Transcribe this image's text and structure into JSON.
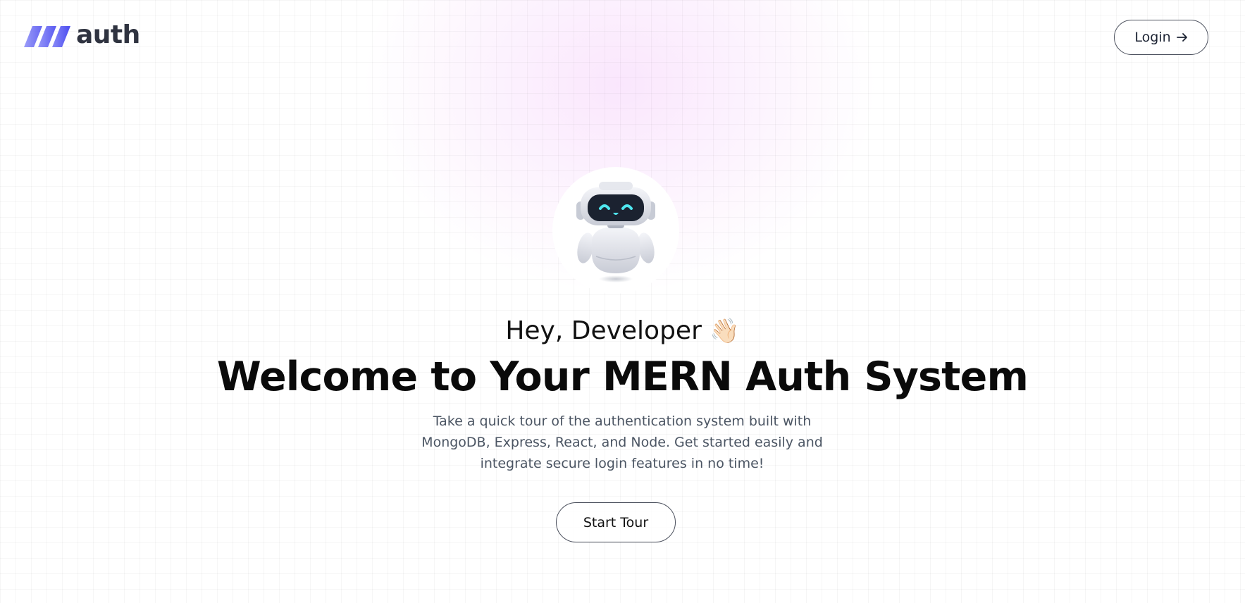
{
  "header": {
    "logo_text": "auth",
    "login_label": "Login",
    "login_icon": "arrow-right-icon"
  },
  "hero": {
    "avatar_icon": "robot-avatar",
    "greeting": "Hey, Developer",
    "greeting_emoji": "👋🏻",
    "headline": "Welcome to Your MERN Auth System",
    "description": "Take a quick tour of the authentication system built with MongoDB, Express, React, and Node. Get started easily and integrate secure login features in no time!",
    "cta_label": "Start Tour"
  },
  "colors": {
    "brand": "#5b5cf0",
    "brand_light": "#8b8cf7",
    "text_dark": "#0a0a0a",
    "text_muted": "#4b5563",
    "glow": "#f4c8fa"
  }
}
